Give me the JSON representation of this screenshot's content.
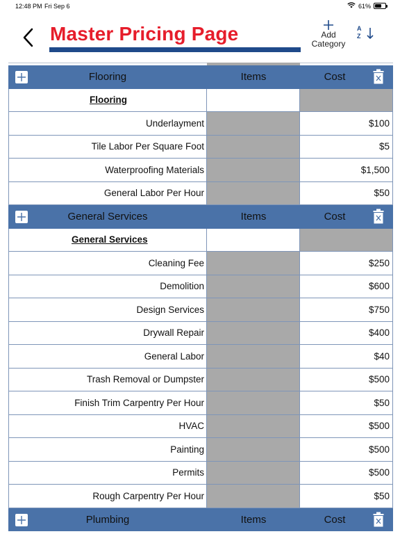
{
  "status_bar": {
    "time": "12:48 PM",
    "date": "Fri Sep 6",
    "battery": "61%",
    "battery_level": 0.61
  },
  "header": {
    "title": "Master Pricing Page",
    "add_category_line1": "Add",
    "add_category_line2": "Category",
    "sort_letters_a": "A",
    "sort_letters_z": "Z",
    "title_color": "#e61d2b",
    "underline_color": "#1f4a8a"
  },
  "columns": {
    "items": "Items",
    "cost": "Cost"
  },
  "theme": {
    "header_blue": "#4a72a8",
    "gray_cell": "#a9a9a9"
  },
  "categories": [
    {
      "name": "Flooring",
      "subheading": "Flooring",
      "rows": [
        {
          "name": "Underlayment",
          "cost": "$100"
        },
        {
          "name": "Tile Labor Per Square Foot",
          "cost": "$5"
        },
        {
          "name": "Waterproofing Materials",
          "cost": "$1,500"
        },
        {
          "name": "General Labor Per Hour",
          "cost": "$50"
        }
      ]
    },
    {
      "name": "General Services",
      "subheading": "General Services",
      "rows": [
        {
          "name": "Cleaning Fee",
          "cost": "$250"
        },
        {
          "name": "Demolition",
          "cost": "$600"
        },
        {
          "name": "Design Services",
          "cost": "$750"
        },
        {
          "name": "Drywall Repair",
          "cost": "$400"
        },
        {
          "name": "General Labor",
          "cost": "$40"
        },
        {
          "name": "Trash Removal or Dumpster",
          "cost": "$500"
        },
        {
          "name": "Finish Trim Carpentry Per Hour",
          "cost": "$50"
        },
        {
          "name": "HVAC",
          "cost": "$500"
        },
        {
          "name": "Painting",
          "cost": "$500"
        },
        {
          "name": "Permits",
          "cost": "$500"
        },
        {
          "name": "Rough Carpentry Per Hour",
          "cost": "$50"
        }
      ]
    },
    {
      "name": "Plumbing",
      "subheading": "",
      "rows": []
    }
  ]
}
